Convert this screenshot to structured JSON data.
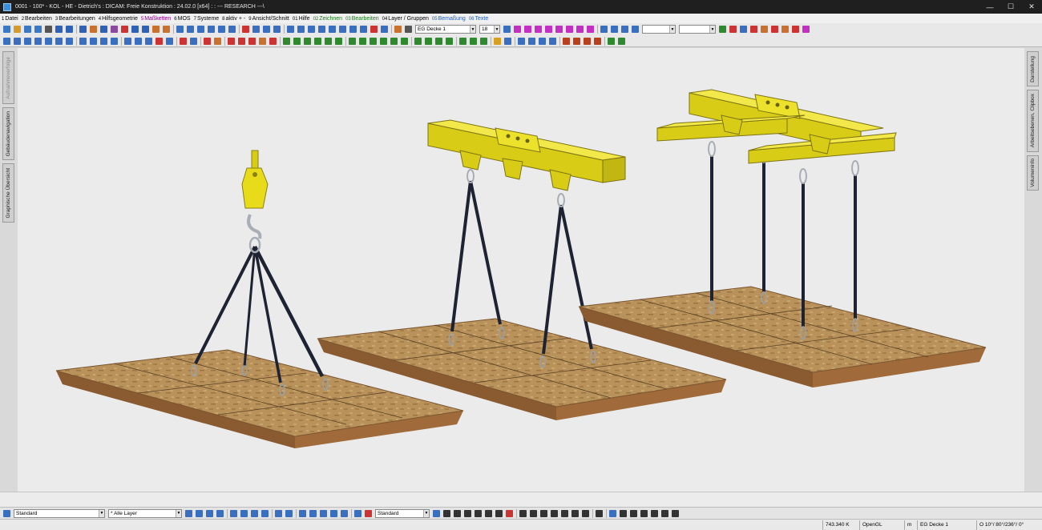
{
  "window": {
    "title": "0001 - 100* - KOL - HE - Dietrich's : DICAM: Freie Konstruktion : 24.02.0 [x64] : : --- RESEARCH ---\\",
    "minimize": "—",
    "maximize": "☐",
    "close": "✕"
  },
  "menu": [
    {
      "num": "1",
      "label": "Datei",
      "color": "#000000"
    },
    {
      "num": "2",
      "label": "Bearbeiten",
      "color": "#000000"
    },
    {
      "num": "3",
      "label": "Bearbeitungen",
      "color": "#000000"
    },
    {
      "num": "4",
      "label": "Hilfsgeometrie",
      "color": "#000000"
    },
    {
      "num": "5",
      "label": "Maßketten",
      "color": "#8b008b"
    },
    {
      "num": "6",
      "label": "MOS",
      "color": "#000000"
    },
    {
      "num": "7",
      "label": "Systeme",
      "color": "#000000"
    },
    {
      "num": "8",
      "label": "aktiv + -",
      "color": "#000000"
    },
    {
      "num": "9",
      "label": "Ansicht/Schnitt",
      "color": "#000000"
    },
    {
      "num": "01",
      "label": "Hilfe",
      "color": "#000000"
    },
    {
      "num": "02",
      "label": "Zeichnen",
      "color": "#1a7a1a"
    },
    {
      "num": "03",
      "label": "Bearbeiten",
      "color": "#1a7a1a"
    },
    {
      "num": "04",
      "label": "Layer / Gruppen",
      "color": "#000000"
    },
    {
      "num": "05",
      "label": "Bemaßung",
      "color": "#1e5fbf"
    },
    {
      "num": "06",
      "label": "Texte",
      "color": "#1e5fbf"
    }
  ],
  "toolbar": {
    "layer_select": "EG Decke 1",
    "size_select": "18",
    "empty_select": ""
  },
  "left_panel": {
    "tabs": [
      "Aufnahmeverfolge",
      "Gebäudenavigation",
      "Graphische Übersicht"
    ]
  },
  "right_panel": {
    "tabs": [
      "Darstellung",
      "Arbeitsebenen, Clipbox",
      "Volumeninfo"
    ]
  },
  "bottom_toolbar": {
    "style_select": "Standard",
    "layer_select": "* Alle Layer",
    "line_style_select": "Standard"
  },
  "status": {
    "coords": "743.340 K",
    "renderer": "OpenGL",
    "unit": "m",
    "layer": "EG Decke 1",
    "view_angles": "O 10°/ 80°/236°/  0°"
  },
  "scene": {
    "object_names": [
      "crane-hook-lift",
      "single-spreader-beam-lift",
      "double-spreader-beam-lift"
    ],
    "colors": {
      "steel": "#e8dc1a",
      "sling": "#1e2333",
      "wood_top": "#b8925a",
      "wood_side": "#9a6638"
    }
  }
}
